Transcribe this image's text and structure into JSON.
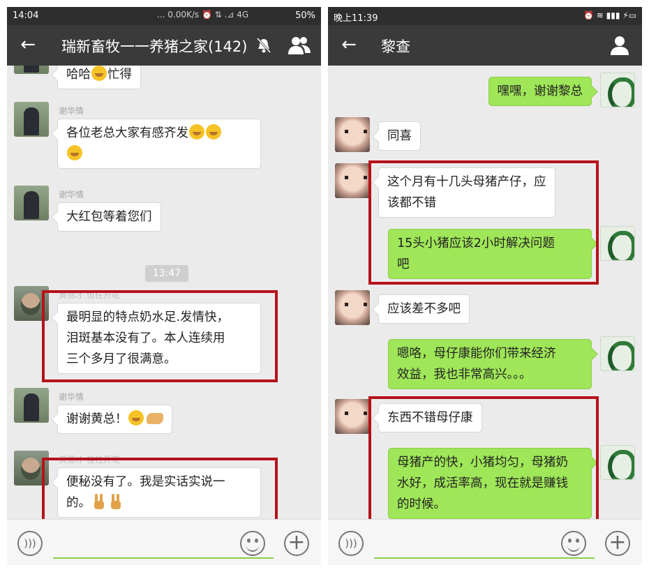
{
  "left": {
    "status": {
      "time": "14:04",
      "network": "... 0.00K/s ⏰ ⇅ .⊿ 4G",
      "battery": "50%"
    },
    "title": "瑞新畜牧一一养猪之家(142)",
    "icons": {
      "back": "back-arrow-icon",
      "mute": "mute-bell-icon",
      "group": "group-members-icon"
    },
    "messages": [
      {
        "type": "in",
        "sender": "",
        "lines": [
          "哈哈",
          "忙得"
        ]
      },
      {
        "type": "in",
        "sender": "谢华情",
        "lines": [
          "各位老总大家有感齐发"
        ]
      },
      {
        "type": "in",
        "sender": "谢华情",
        "lines": [
          "大红包等着您们"
        ]
      },
      {
        "type": "time",
        "text": "13:47"
      },
      {
        "type": "in",
        "sender": "黄德才 恒柱开花",
        "lines": [
          "最明显的特点奶水足.发情快，",
          "泪斑基本没有了。本人连续用",
          "三个多月了很满意。"
        ]
      },
      {
        "type": "in",
        "sender": "谢华情",
        "lines": [
          "谢谢黄总！"
        ]
      },
      {
        "type": "in",
        "sender": "黄德才 桂柱开花",
        "lines": [
          "便秘没有了。我是实话实说一",
          "的。"
        ]
      }
    ],
    "input": {
      "voice": "voice-icon",
      "emoji": "emoji-icon",
      "plus": "plus-icon"
    }
  },
  "right": {
    "status": {
      "time": "晚上11:39"
    },
    "title": "黎查",
    "icons": {
      "back": "back-arrow-icon",
      "profile": "person-icon"
    },
    "messages": [
      {
        "type": "out",
        "lines": [
          "嘿嘿，谢谢黎总"
        ]
      },
      {
        "type": "in",
        "lines": [
          "同喜"
        ]
      },
      {
        "type": "in",
        "lines": [
          "这个月有十几头母猪产仔，应",
          "该都不错"
        ]
      },
      {
        "type": "out",
        "lines": [
          "15头小猪应该2小时解决问题",
          "吧"
        ]
      },
      {
        "type": "in",
        "lines": [
          "应该差不多吧"
        ]
      },
      {
        "type": "out",
        "lines": [
          "嗯咯，母仔康能你们带来经济",
          "效益，我也非常高兴。。。"
        ]
      },
      {
        "type": "in",
        "lines": [
          "东西不错母仔康"
        ]
      },
      {
        "type": "out",
        "lines": [
          "母猪产的快，小猪均匀，母猪奶",
          "水好，成活率高，现在就是赚钱",
          "的时候。"
        ]
      }
    ],
    "input": {
      "voice": "voice-icon",
      "emoji": "emoji-icon",
      "plus": "plus-icon"
    }
  },
  "colors": {
    "highlight": "#b5121b",
    "bubble_out": "#9fe658",
    "bubble_in": "#ffffff",
    "topbar": "#3a3a3a"
  }
}
